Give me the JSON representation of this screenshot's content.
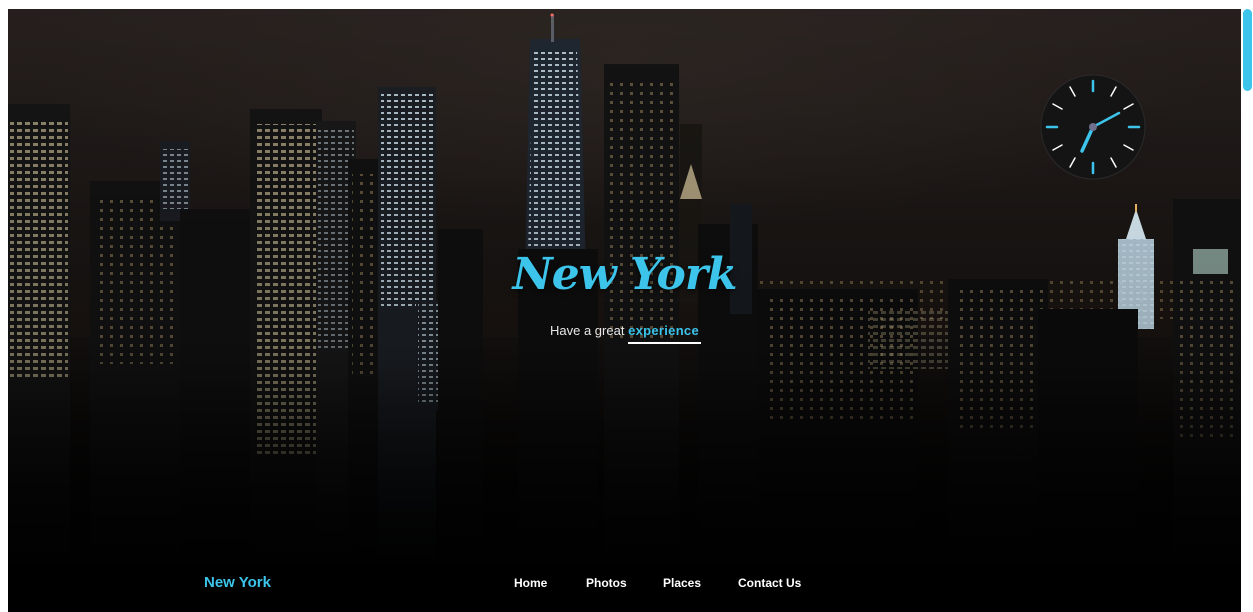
{
  "hero": {
    "title": "New York",
    "subtitle_prefix": "Have a great",
    "subtitle_accent": "experience"
  },
  "nav": {
    "brand": "New York",
    "links": [
      "Home",
      "Photos",
      "Places",
      "Contact Us"
    ]
  },
  "clock": {
    "hour_hand_angle_label": "hour-hand",
    "minute_hand_angle_label": "minute-hand"
  },
  "colors": {
    "accent": "#3cc4ea",
    "text": "#ffffff",
    "clock_face": "#141414"
  },
  "icons": {
    "clock": "analog-clock-icon"
  }
}
